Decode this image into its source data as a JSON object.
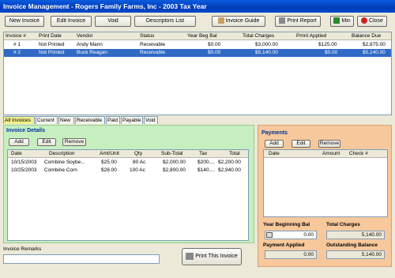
{
  "window": {
    "title": "Invoice Management - Rogers Family Farms, Inc - 2003 Tax Year"
  },
  "toolbar": {
    "new_invoice": "New Invoice",
    "edit_invoice": "Edit Invoice",
    "void": "Void",
    "descriptors_list": "Descriptors List",
    "invoice_guide": "Invoice Guide",
    "print_report": "Print Report",
    "min": "Min",
    "close": "Close"
  },
  "invoice_grid": {
    "headers": [
      "Invoice #",
      "Print Date",
      "Vendor",
      "Status",
      "Year Beg Bal",
      "Total Charges",
      "Pmnt Applied",
      "Balance Due"
    ],
    "rows": [
      [
        "# 1",
        "Not Printed",
        "Andy Mann",
        "Receivable",
        "$0.00",
        "$3,000.00",
        "$125.00",
        "$2,875.00"
      ],
      [
        "# 2",
        "Not Printed",
        "Buck Reagan",
        "Receivable",
        "$0.00",
        "$5,140.00",
        "$0.00",
        "$5,140.00"
      ]
    ],
    "selected_row": 1
  },
  "tabs": [
    "All Invoices",
    "Current",
    "New",
    "Receivable",
    "Paid",
    "Payable",
    "Void"
  ],
  "active_tab": "All Invoices",
  "invoice_details": {
    "title": "Invoice Details",
    "add": "Add",
    "edit": "Edit",
    "remove": "Remove",
    "headers": [
      "Date",
      "Description",
      "Amt/Unit",
      "Qty",
      "Sub-Total",
      "Tax",
      "Total"
    ],
    "rows": [
      [
        "10/15/2003",
        "Combine Soybe...",
        "$25.00",
        "80 Ac",
        "$2,000.00",
        "$200....",
        "$2,200.00"
      ],
      [
        "10/25/2003",
        "Combine Corn",
        "$28.00",
        "100 Ac",
        "$2,800.00",
        "$140....",
        "$2,940.00"
      ]
    ]
  },
  "payments": {
    "title": "Payments",
    "add": "Add",
    "edit": "Edit",
    "remove": "Remove",
    "headers": [
      "Date",
      "Amount",
      "Check #"
    ],
    "year_beginning_bal_label": "Year Beginning Bal",
    "year_beginning_bal": "0.00",
    "total_charges_label": "Total Charges",
    "total_charges": "5,140.00",
    "payment_applied_label": "Payment Applied",
    "payment_applied": "0.00",
    "outstanding_balance_label": "Outstanding Balance",
    "outstanding_balance": "5,140.00"
  },
  "remarks": {
    "label": "Invoice Remarks",
    "value": ""
  },
  "print_invoice": "Print This Invoice"
}
